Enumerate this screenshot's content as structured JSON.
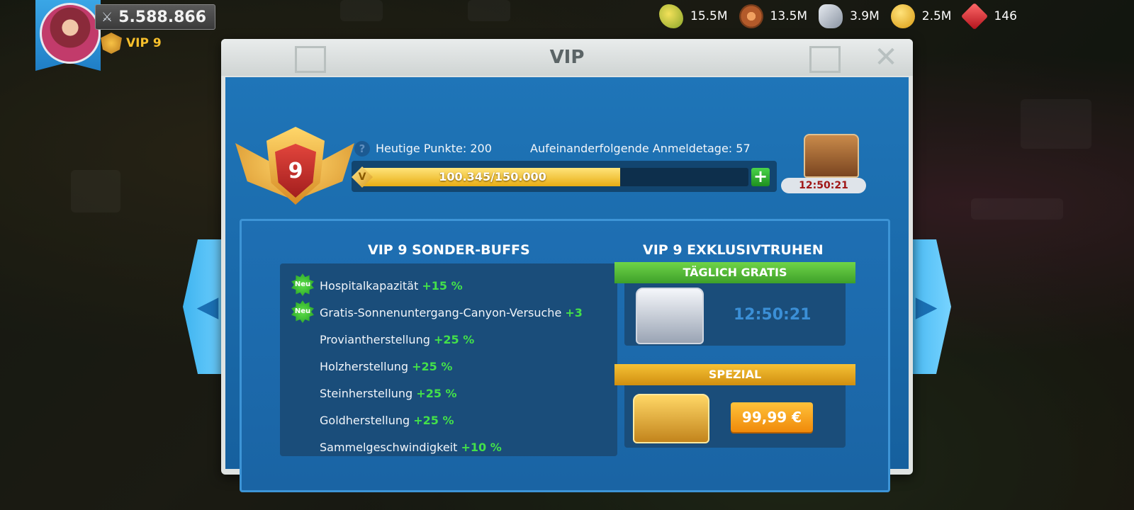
{
  "player": {
    "power": "5.588.866",
    "vip_label": "VIP 9"
  },
  "resources": [
    {
      "icon": "corn-icon",
      "value": "15.5M"
    },
    {
      "icon": "wood-icon",
      "value": "13.5M"
    },
    {
      "icon": "stone-icon",
      "value": "3.9M"
    },
    {
      "icon": "gold-icon",
      "value": "2.5M"
    },
    {
      "icon": "gem-icon",
      "value": "146"
    }
  ],
  "modal": {
    "title": "VIP",
    "close_glyph": "✕",
    "vip_level": "9",
    "today_points": "Heutige Punkte: 200",
    "consecutive_days": "Aufeinanderfolgende Anmeldetage: 57",
    "progress_text": "100.345/150.000",
    "progress_fraction": 0.669,
    "bar_gem_glyph": "V",
    "plus_glyph": "+",
    "chest_timer": "12:50:21"
  },
  "buffs": {
    "title": "VIP 9 SONDER-BUFFS",
    "new_badge": "Neu",
    "items": [
      {
        "label": "Hospitalkapazität",
        "bonus": "+15 %",
        "is_new": true
      },
      {
        "label": "Gratis-Sonnenuntergang-Canyon-Versuche",
        "bonus": "+3",
        "is_new": true
      },
      {
        "label": "Proviantherstellung",
        "bonus": "+25 %",
        "is_new": false
      },
      {
        "label": "Holzherstellung",
        "bonus": "+25 %",
        "is_new": false
      },
      {
        "label": "Steinherstellung",
        "bonus": "+25 %",
        "is_new": false
      },
      {
        "label": "Goldherstellung",
        "bonus": "+25 %",
        "is_new": false
      },
      {
        "label": "Sammelgeschwindigkeit",
        "bonus": "+10 %",
        "is_new": false
      }
    ]
  },
  "chests": {
    "title": "VIP 9 EXKLUSIVTRUHEN",
    "daily_label": "TÄGLICH GRATIS",
    "daily_timer": "12:50:21",
    "special_label": "SPEZIAL",
    "special_price": "99,99 €"
  },
  "nav": {
    "left_glyph": "◀",
    "right_glyph": "▶"
  },
  "colors": {
    "accent_blue": "#1f75b8",
    "bonus_green": "#43e04a",
    "gold": "#f8c02c",
    "timer_red": "#a01616"
  }
}
